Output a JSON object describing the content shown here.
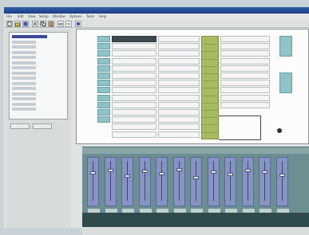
{
  "app": {
    "title": ""
  },
  "menu": {
    "items": [
      "File",
      "Edit",
      "View",
      "Setup",
      "Window",
      "Options",
      "Tools",
      "Help"
    ]
  },
  "toolbar": {
    "icons": [
      "new-icon",
      "open-icon",
      "save-icon",
      "cut-icon",
      "copy-icon",
      "paste-icon",
      "print-icon",
      "undo-icon",
      "help-icon"
    ]
  },
  "left_panel": {
    "tree_items": [
      "",
      "",
      "",
      "",
      "",
      "",
      "",
      "",
      "",
      "",
      "",
      "",
      "",
      "",
      ""
    ],
    "buttons": [
      "",
      ""
    ]
  },
  "routing": {
    "row_labels": [
      "",
      "",
      "",
      "",
      "",
      "",
      "",
      "",
      "",
      "",
      "",
      "",
      "",
      ""
    ],
    "output_labels": [
      "",
      "",
      "",
      ""
    ],
    "legend_caption": ""
  },
  "mixer": {
    "channel_levels": [
      0.72,
      0.8,
      0.65,
      0.78,
      0.7,
      0.82,
      0.6,
      0.75,
      0.68,
      0.8,
      0.74,
      0.66
    ]
  },
  "colors": {
    "input_block": "#8fc3c8",
    "matrix": "#a6bb62",
    "channel_strip": "#8793c3",
    "mixer_bg": "#6c8f92"
  }
}
